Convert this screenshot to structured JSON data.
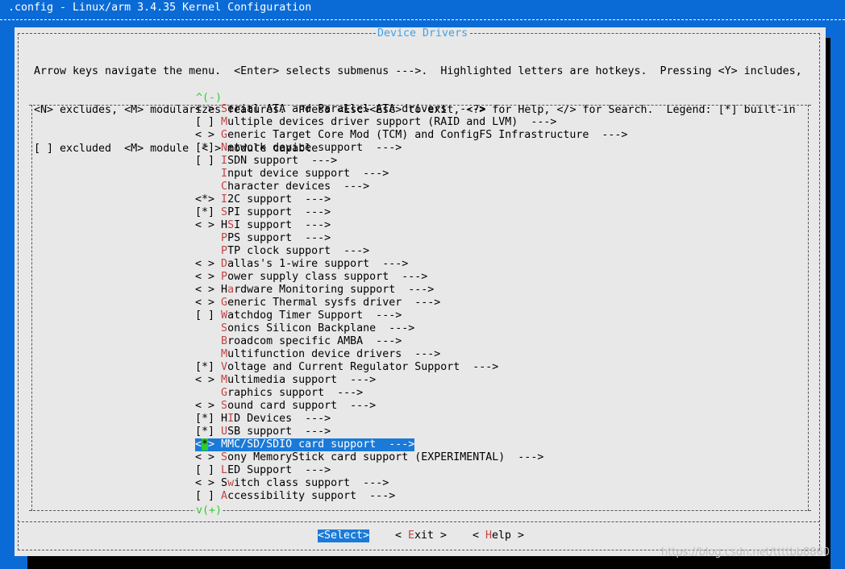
{
  "window": {
    "title": ".config - Linux/arm 3.4.35 Kernel Configuration"
  },
  "dialog": {
    "title": "Device Drivers",
    "help_lines": [
      "Arrow keys navigate the menu.  <Enter> selects submenus --->.  Highlighted letters are hotkeys.  Pressing <Y> includes,",
      "<N> excludes, <M> modularizes features.  Press <Esc><Esc> to exit, <?> for Help, </> for Search.  Legend: [*] built-in",
      "[ ] excluded  <M> module  < > module capable"
    ],
    "scroll_up_indicator": "^(-)",
    "scroll_down_indicator": "v(+)"
  },
  "menu": {
    "selected_index": 26,
    "items": [
      {
        "mark": "< >",
        "hotkey": "S",
        "rest": "erial ATA and Parallel ATA drivers  --->"
      },
      {
        "mark": "[ ]",
        "hotkey": "M",
        "rest": "ultiple devices driver support (RAID and LVM)  --->"
      },
      {
        "mark": "< >",
        "hotkey": "G",
        "rest": "eneric Target Core Mod (TCM) and ConfigFS Infrastructure  --->"
      },
      {
        "mark": "[*]",
        "hotkey": "N",
        "rest": "etwork device support  --->"
      },
      {
        "mark": "[ ]",
        "hotkey": "I",
        "rest": "SDN support  --->"
      },
      {
        "mark": "   ",
        "hotkey": "I",
        "rest": "nput device support  --->"
      },
      {
        "mark": "   ",
        "hotkey": "C",
        "rest": "haracter devices  --->"
      },
      {
        "mark": "<*>",
        "hotkey": "I",
        "rest": "2C support  --->"
      },
      {
        "mark": "[*]",
        "hotkey": "S",
        "rest": "PI support  --->"
      },
      {
        "mark": "< >",
        "prefix": "H",
        "hotkey": "S",
        "rest": "I support  --->"
      },
      {
        "mark": "   ",
        "hotkey": "P",
        "rest": "PS support  --->"
      },
      {
        "mark": "   ",
        "hotkey": "P",
        "rest": "TP clock support  --->"
      },
      {
        "mark": "< >",
        "hotkey": "D",
        "rest": "allas's 1-wire support  --->"
      },
      {
        "mark": "< >",
        "hotkey": "P",
        "rest": "ower supply class support  --->"
      },
      {
        "mark": "< >",
        "prefix": "H",
        "hotkey": "a",
        "rest": "rdware Monitoring support  --->"
      },
      {
        "mark": "< >",
        "hotkey": "G",
        "rest": "eneric Thermal sysfs driver  --->"
      },
      {
        "mark": "[ ]",
        "hotkey": "W",
        "rest": "atchdog Timer Support  --->"
      },
      {
        "mark": "   ",
        "hotkey": "S",
        "rest": "onics Silicon Backplane  --->"
      },
      {
        "mark": "   ",
        "hotkey": "B",
        "rest": "roadcom specific AMBA  --->"
      },
      {
        "mark": "   ",
        "hotkey": "M",
        "rest": "ultifunction device drivers  --->"
      },
      {
        "mark": "[*]",
        "hotkey": "V",
        "rest": "oltage and Current Regulator Support  --->"
      },
      {
        "mark": "< >",
        "hotkey": "M",
        "rest": "ultimedia support  --->"
      },
      {
        "mark": "   ",
        "hotkey": "G",
        "rest": "raphics support  --->"
      },
      {
        "mark": "< >",
        "hotkey": "S",
        "rest": "ound card support  --->"
      },
      {
        "mark": "[*]",
        "prefix": "H",
        "hotkey": "I",
        "rest": "D Devices  --->"
      },
      {
        "mark": "[*]",
        "hotkey": "U",
        "rest": "SB support  --->"
      },
      {
        "mark": "<*>",
        "hotkey": "M",
        "rest": "MC/SD/SDIO card support  --->"
      },
      {
        "mark": "< >",
        "hotkey": "S",
        "rest": "ony MemoryStick card support (EXPERIMENTAL)  --->"
      },
      {
        "mark": "[ ]",
        "hotkey": "L",
        "rest": "ED Support  --->"
      },
      {
        "mark": "< >",
        "prefix": "S",
        "hotkey": "w",
        "rest": "itch class support  --->"
      },
      {
        "mark": "[ ]",
        "hotkey": "A",
        "rest": "ccessibility support  --->"
      }
    ]
  },
  "buttons": {
    "select": {
      "open": "<",
      "hotkey": "S",
      "rest": "elect>"
    },
    "exit": {
      "open": "< ",
      "hotkey": "E",
      "rest": "xit >"
    },
    "help": {
      "open": "< ",
      "hotkey": "H",
      "rest": "elp >"
    }
  },
  "watermark": "https://blog.csdn.net/ttttbb8860",
  "colors": {
    "background": "#0b6bd6",
    "dialog": "#e8e8e8",
    "highlight": "#1a7ad8",
    "hotkey": "#c44343",
    "scroll_indicator": "#2ecc2e",
    "title": "#3fa0e8"
  }
}
